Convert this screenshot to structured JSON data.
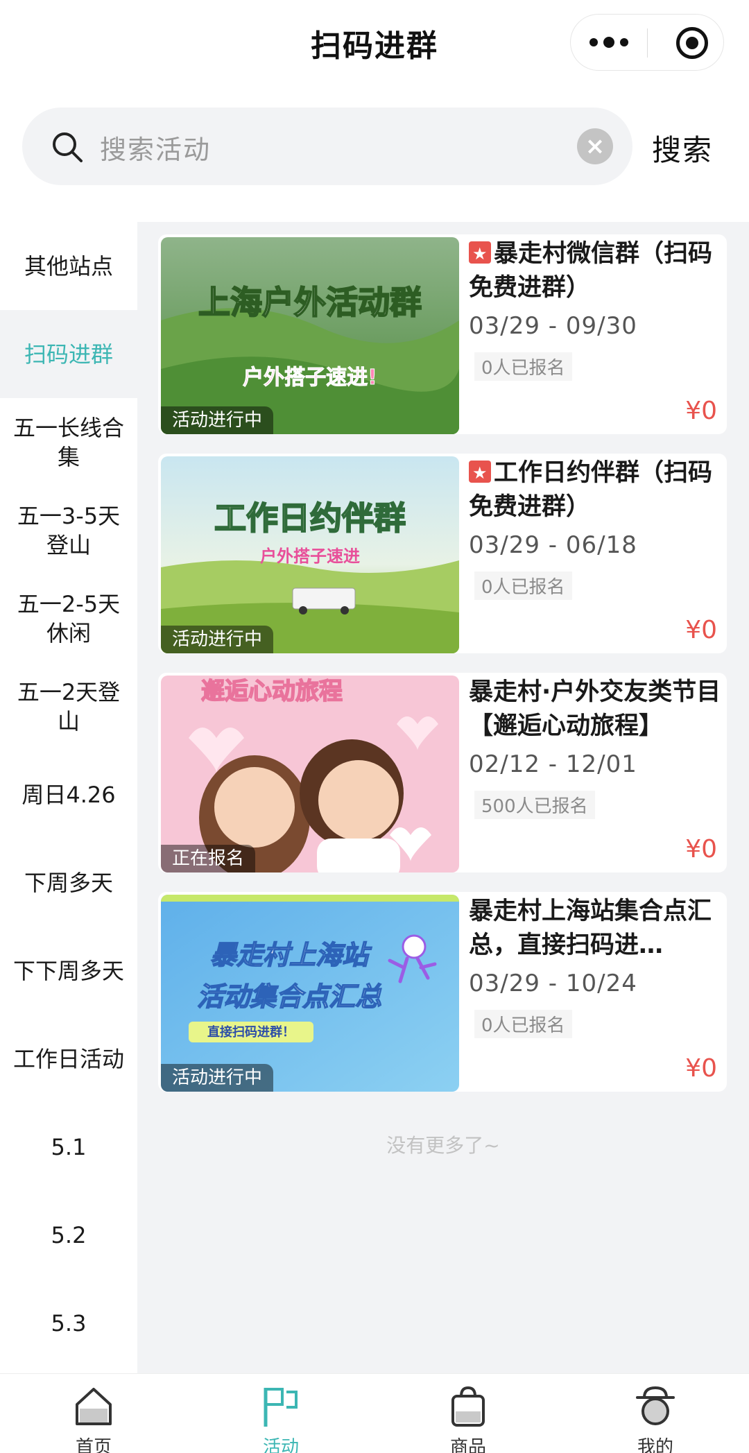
{
  "header": {
    "title": "扫码进群"
  },
  "search": {
    "placeholder": "搜索活动",
    "button_label": "搜索"
  },
  "sidebar": {
    "items": [
      {
        "label": "其他站点"
      },
      {
        "label": "扫码进群",
        "active": true
      },
      {
        "label": "五一长线合集"
      },
      {
        "label": "五一3-5天登山"
      },
      {
        "label": "五一2-5天休闲"
      },
      {
        "label": "五一2天登山"
      },
      {
        "label": "周日4.26"
      },
      {
        "label": "下周多天"
      },
      {
        "label": "下下周多天"
      },
      {
        "label": "工作日活动"
      },
      {
        "label": "5.1"
      },
      {
        "label": "5.2"
      },
      {
        "label": "5.3"
      }
    ]
  },
  "cards": [
    {
      "badge": true,
      "title": "暴走村微信群（扫码免费进群）",
      "date": "03/29 - 09/30",
      "signup": "0人已报名",
      "price": "¥0",
      "status": "活动进行中",
      "image_title": "上海户外活动群",
      "image_subtitle": "户外搭子速进!"
    },
    {
      "badge": true,
      "title": "工作日约伴群（扫码免费进群）",
      "date": "03/29 - 06/18",
      "signup": "0人已报名",
      "price": "¥0",
      "status": "活动进行中",
      "image_title": "工作日约伴群",
      "image_subtitle": "户外搭子速进"
    },
    {
      "badge": false,
      "title": "暴走村·户外交友类节目【邂逅心动旅程】",
      "date": "02/12 - 12/01",
      "signup": "500人已报名",
      "price": "¥0",
      "status": "正在报名",
      "image_title": "邂逅心动旅程"
    },
    {
      "badge": false,
      "title": "暴走村上海站集合点汇总，直接扫码进…",
      "date": "03/29 - 10/24",
      "signup": "0人已报名",
      "price": "¥0",
      "status": "活动进行中",
      "image_title": "暴走村上海站",
      "image_title2": "活动集合点汇总",
      "image_subtitle": "直接扫码进群！"
    }
  ],
  "list_end_text": "没有更多了~",
  "tabbar": {
    "items": [
      {
        "label": "首页",
        "icon": "home-icon"
      },
      {
        "label": "活动",
        "icon": "flag-icon",
        "active": true
      },
      {
        "label": "商品",
        "icon": "bag-icon"
      },
      {
        "label": "我的",
        "icon": "profile-icon"
      }
    ]
  },
  "colors": {
    "accent": "#3cb6b3",
    "price": "#e8534d",
    "background": "#f2f3f5"
  }
}
